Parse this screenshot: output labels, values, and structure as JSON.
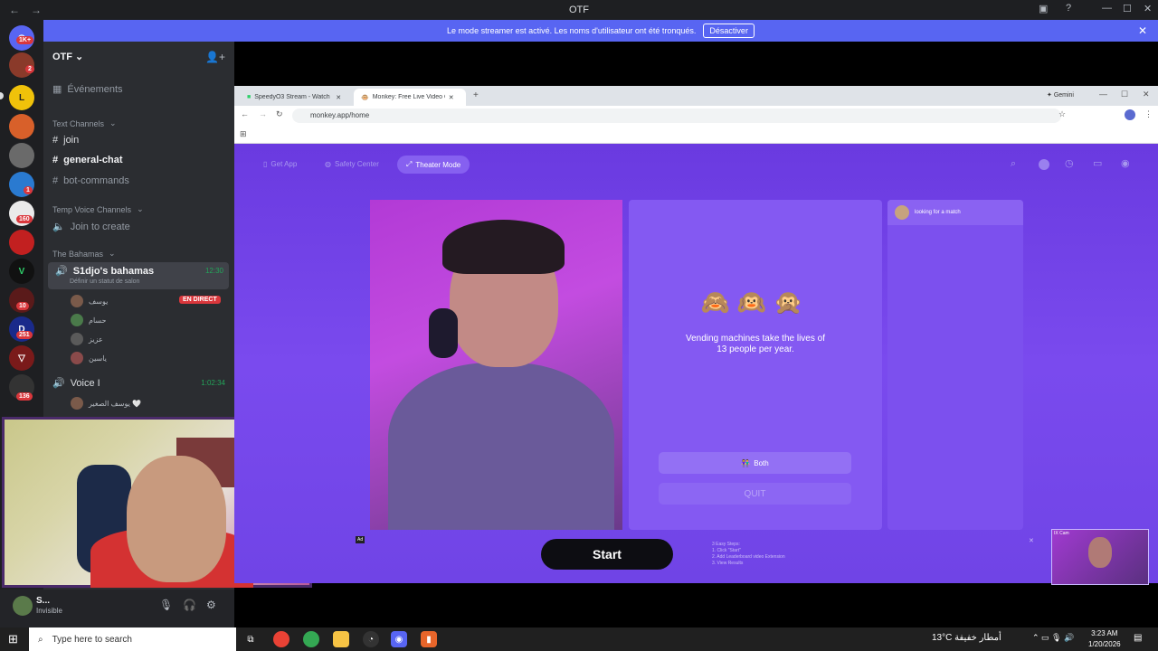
{
  "window": {
    "title": "OTF"
  },
  "banner": {
    "text": "Le mode streamer est activé. Les noms d'utilisateur ont été tronqués.",
    "button": "Désactiver"
  },
  "rail": {
    "badges": [
      "1K+",
      "2",
      "1",
      "160",
      "10",
      "251",
      "136"
    ]
  },
  "sidebar": {
    "server_name": "OTF",
    "events": "Événements",
    "text_category": "Text Channels",
    "text_channels": [
      "join",
      "general-chat",
      "bot-commands"
    ],
    "voice_category": "Temp Voice Channels",
    "voice_create": "Join to create",
    "bahamas_category": "The Bahamas",
    "active_vc": {
      "name": "S1djo's bahamas",
      "timer": "12:30",
      "status": "Définir un statut de salon"
    },
    "vc_users": [
      "يوسف",
      "حسام",
      "عزيز",
      "ياسين"
    ],
    "live_label": "EN DIRECT",
    "voice1": {
      "name": "Voice I",
      "timer": "1:02:34"
    },
    "voice1_users": [
      "يوسف الصغير 🤍"
    ]
  },
  "userpanel": {
    "name": "S...",
    "status": "Invisible"
  },
  "browser": {
    "tabs": [
      "SpeedyO3 Stream - Watch Live",
      "Monkey: Free Live Video Chat"
    ],
    "gemini": "Gemini",
    "url": "monkey.app/home",
    "site_nav": [
      "Get App",
      "Safety Center",
      "Theater Mode"
    ],
    "match": "looking for a match",
    "emojis": "🙈🙉🙊",
    "fact": "Vending machines take the lives of 13 people per year.",
    "both": "Both",
    "quit": "QUIT",
    "start": "Start",
    "ad": "Ad",
    "steps": [
      "3 Easy Steps:",
      "1. Click \"Start\"",
      "2. Add Leaderboard video Extension",
      "3. View Results"
    ],
    "pip_label": "IX Cam"
  },
  "taskbar": {
    "search": "Type here to search",
    "weather": "13°C  أمطار خفيفة",
    "time": "3:23 AM",
    "date": "1/20/2026"
  }
}
